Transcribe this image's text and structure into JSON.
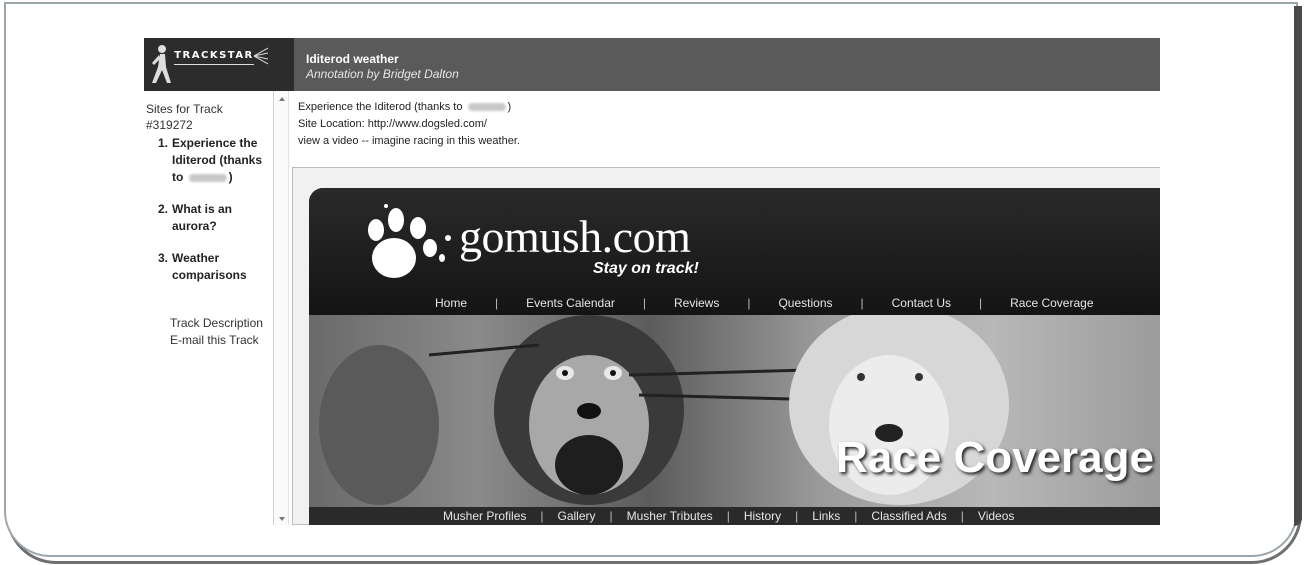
{
  "trackstar": {
    "logo_text": "TRACKSTAR",
    "title": "Iditerod weather",
    "annotation": "Annotation by Bridget Dalton"
  },
  "sidebar": {
    "heading_line1": "Sites for Track",
    "heading_line2": "#319272",
    "items": [
      {
        "num": "1.",
        "label": "Experience the Iditerod (thanks to",
        "suffix": ")"
      },
      {
        "num": "2.",
        "label": "What is an aurora?"
      },
      {
        "num": "3.",
        "label": "Weather comparisons"
      }
    ],
    "links": [
      "Track Description",
      "E-mail this Track"
    ]
  },
  "site_info": {
    "line1_prefix": "Experience the Iditerod (thanks to",
    "line1_suffix": ")",
    "line2": "Site Location: http://www.dogsled.com/",
    "line3": "view a video -- imagine racing in this weather."
  },
  "embedded_site": {
    "brand": "gomush.com",
    "tagline": "Stay on track!",
    "top_nav": [
      "Home",
      "Events Calendar",
      "Reviews",
      "Questions",
      "Contact Us",
      "Race Coverage"
    ],
    "hero_text": "Race Coverage",
    "bottom_nav": [
      "Musher Profiles",
      "Gallery",
      "Musher Tributes",
      "History",
      "Links",
      "Classified Ads",
      "Videos"
    ],
    "separator": "|"
  }
}
